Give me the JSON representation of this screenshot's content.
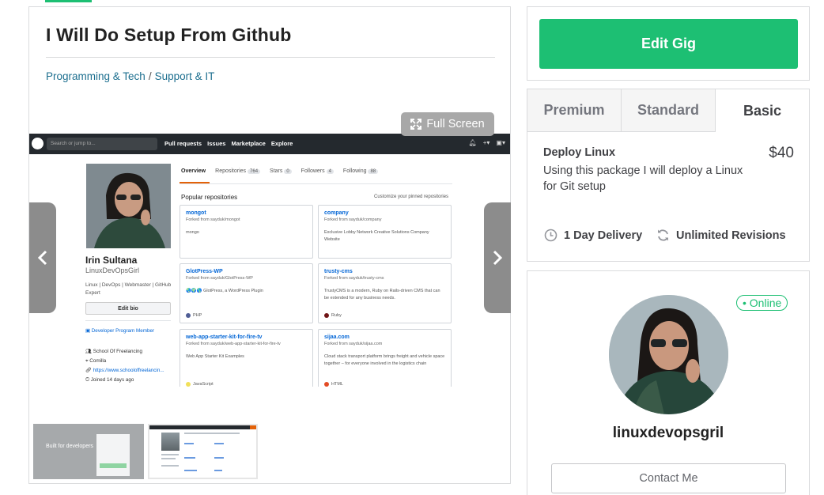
{
  "gig": {
    "title": "I Will Do Setup From Github",
    "breadcrumb": [
      "Programming & Tech",
      "/",
      "Support & IT"
    ],
    "fullscreen_label": "Full Screen"
  },
  "gallery": {
    "github_nav": [
      "Pull requests",
      "Issues",
      "Marketplace",
      "Explore"
    ],
    "search_placeholder": "Search or jump to...",
    "profile": {
      "name": "Irin Sultana",
      "login": "LinuxDevOpsGirl",
      "bio": "Linux | DevOps | Webmaster | GitHub Expert",
      "edit_bio": "Edit bio",
      "member": "Developer Program Member",
      "org": "School Of Freelancing",
      "location": "Comilla",
      "website": "https://www.schooloffreelancin...",
      "joined": "Joined 14 days ago"
    },
    "tabs": [
      {
        "label": "Overview",
        "count": ""
      },
      {
        "label": "Repositories",
        "count": "764"
      },
      {
        "label": "Stars",
        "count": "0"
      },
      {
        "label": "Followers",
        "count": "4"
      },
      {
        "label": "Following",
        "count": "88"
      }
    ],
    "popular_title": "Popular repositories",
    "customize": "Customize your pinned repositories",
    "repos": [
      {
        "name": "mongot",
        "fork": "Forked from sayduk/mongot",
        "desc": "mongo",
        "lang": "",
        "color": "#ffffff"
      },
      {
        "name": "company",
        "fork": "Forked from sayduk/company",
        "desc": "Exclusive Lobby Network Creative Solutions Company Website",
        "lang": "",
        "color": "#ffffff"
      },
      {
        "name": "GlotPress-WP",
        "fork": "Forked from sayduk/GlotPress-WP",
        "desc": "🌏🌍🌎 GlotPress, a WordPress Plugin",
        "lang": "PHP",
        "color": "#4F5D95"
      },
      {
        "name": "trusty-cms",
        "fork": "Forked from sayduk/trusty-cms",
        "desc": "TrustyCMS is a modern, Ruby on Rails-driven CMS that can be extended for any business needs.",
        "lang": "Ruby",
        "color": "#701516"
      },
      {
        "name": "web-app-starter-kit-for-fire-tv",
        "fork": "Forked from sayduk/web-app-starter-kit-for-fire-tv",
        "desc": "Web App Starter Kit Examples",
        "lang": "JavaScript",
        "color": "#f1e05a"
      },
      {
        "name": "sijaa.com",
        "fork": "Forked from sayduk/sijaa.com",
        "desc": "Cloud stack transport platform brings freight and vehicle space together – for everyone involved in the logistics chain",
        "lang": "HTML",
        "color": "#e34c26"
      }
    ],
    "thumb1_text": "Built for developers"
  },
  "actions": {
    "edit_gig": "Edit Gig"
  },
  "packages": {
    "tabs": [
      "Premium",
      "Standard",
      "Basic"
    ],
    "active_tab": "Basic",
    "title": "Deploy Linux",
    "price": "$40",
    "description": "Using this package I will deploy a Linux for Git setup",
    "delivery": "1 Day Delivery",
    "revisions": "Unlimited Revisions"
  },
  "seller": {
    "status": "• Online",
    "username": "linuxdevopsgril",
    "contact_label": "Contact Me"
  },
  "colors": {
    "brand_green": "#1dbf73",
    "link_teal": "#1d6f8f",
    "github_dark": "#24292e"
  }
}
